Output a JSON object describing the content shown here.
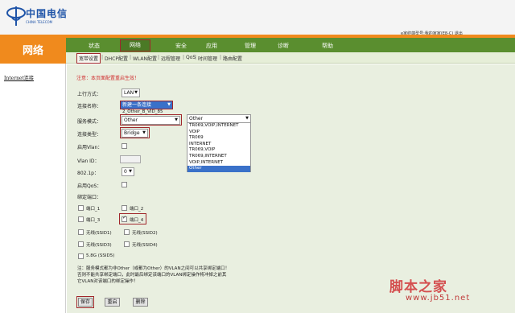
{
  "brand": {
    "name": "中国电信",
    "sub": "CHINA TELECOM",
    "color": "#1f54a8"
  },
  "colors": {
    "accent_orange": "#f08a1d",
    "nav_green": "#5a8e2f",
    "highlight_red": "#a0262b"
  },
  "account": {
    "text": "e家终端型号:我的家家(E8-C)   退出"
  },
  "sidebar": {
    "title": "网络",
    "link": "Internet连接"
  },
  "nav": {
    "tabs": [
      {
        "label": "状态"
      },
      {
        "label": "网络"
      },
      {
        "label": "安全"
      },
      {
        "label": "应用"
      },
      {
        "label": "管理"
      },
      {
        "label": "诊断"
      },
      {
        "label": "帮助"
      }
    ],
    "active": "网络"
  },
  "subnav": {
    "items": [
      {
        "label": "宽带设置"
      },
      {
        "label": "DHCP配置"
      },
      {
        "label": "WLAN配置"
      },
      {
        "label": "远程管理"
      },
      {
        "label": "QoS"
      },
      {
        "label": "时间管理"
      },
      {
        "label": "路由配置"
      }
    ]
  },
  "form": {
    "notice": "注意：本页面配置重启生效！",
    "uplink": {
      "label": "上行方式：",
      "value": "LAN"
    },
    "conn_name": {
      "label": "连接名称：",
      "value": "新建一条连接",
      "hint": "2_Other_B_VID_85"
    },
    "service_mode": {
      "label": "服务模式：",
      "value": "Other"
    },
    "secondary_select": {
      "value": "Other"
    },
    "conn_type": {
      "label": "连接类型：",
      "value": "Bridge"
    },
    "vlan_enable": {
      "label": "启用Vlan："
    },
    "vlan_id": {
      "label": "Vlan ID："
    },
    "dot1p": {
      "label": "802.1p：",
      "value": "0"
    },
    "qos_enable": {
      "label": "启用QoS："
    },
    "bind_ports": {
      "label": "绑定端口：",
      "ports": [
        {
          "label": "端口_1",
          "checked": false
        },
        {
          "label": "端口_2",
          "checked": false
        },
        {
          "label": "端口_3",
          "checked": false
        },
        {
          "label": "端口_4",
          "checked": true
        },
        {
          "label": "无线(SSID1)",
          "checked": false
        },
        {
          "label": "无线(SSID2)",
          "checked": false
        },
        {
          "label": "无线(SSID3)",
          "checked": false
        },
        {
          "label": "无线(SSID4)",
          "checked": false
        },
        {
          "label": "5.8G (SSID5)",
          "checked": false
        }
      ]
    },
    "dropdown_options": [
      "TR069,VOIP,INTERNET",
      "VOIP",
      "TR069",
      "INTERNET",
      "TR069,VOIP",
      "TR069,INTERNET",
      "VOIP,INTERNET",
      "Other"
    ],
    "dropdown_selected": "Other",
    "notes": [
      "注：服务模式都为非Other（或都为Other）的VLAN之间可以共享绑定端口！",
      "否则不能共享绑定端口，此时最后绑定该端口的VLAN绑定操作将冲掉之前其",
      "它VLAN对该端口的绑定操作！"
    ]
  },
  "buttons": {
    "save": "保存",
    "reset": "重启",
    "delete": "删除"
  },
  "watermark": {
    "title": "脚本之家",
    "url": "www.jb51.net"
  }
}
